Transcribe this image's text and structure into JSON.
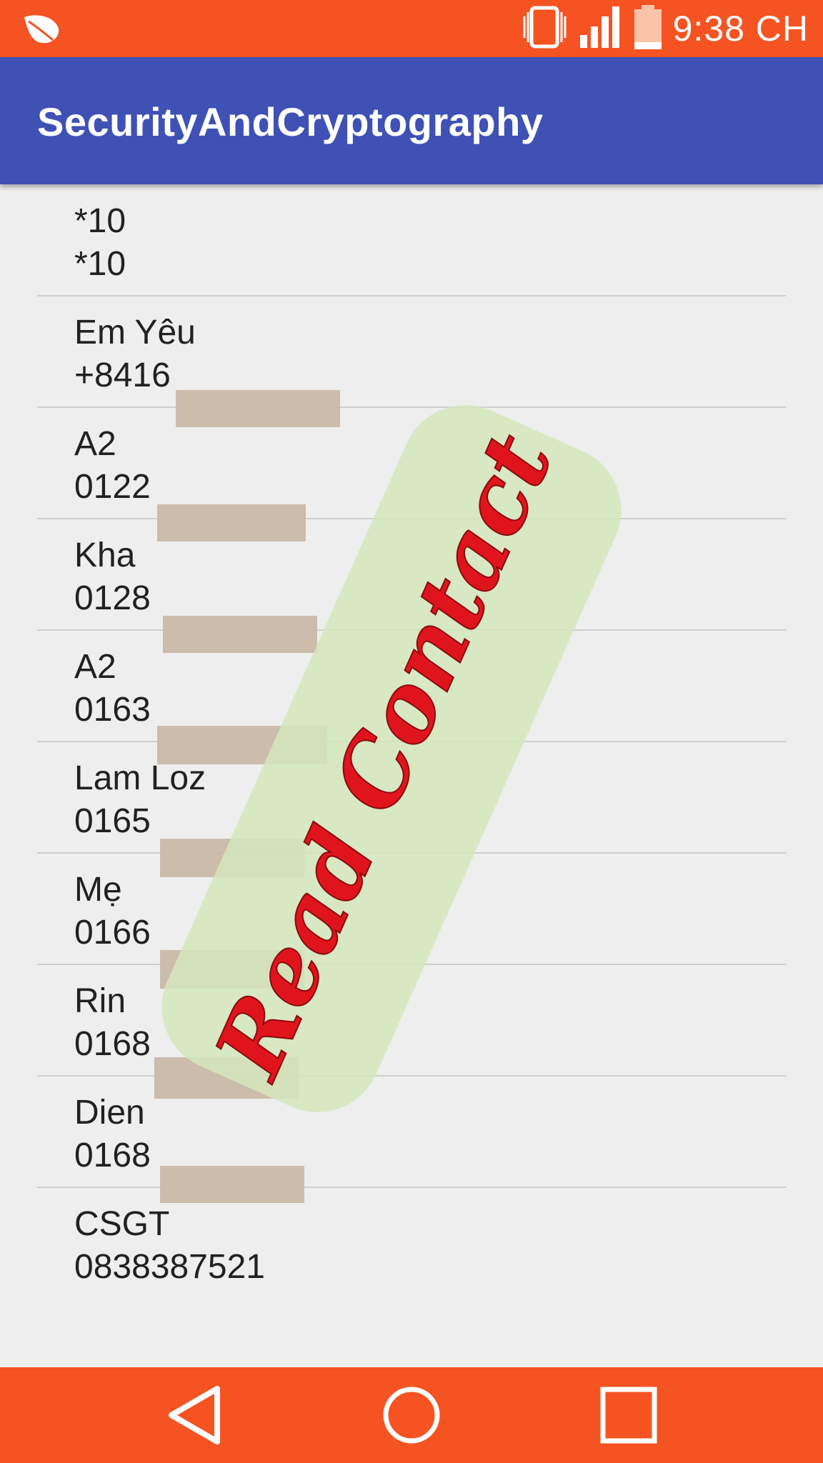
{
  "status_bar": {
    "time": "9:38 CH",
    "icons": [
      "leaf-icon",
      "vibrate-icon",
      "signal-icon",
      "battery-icon"
    ]
  },
  "app_bar": {
    "title": "SecurityAndCryptography"
  },
  "contacts": [
    {
      "name": "*10",
      "phone": "*10"
    },
    {
      "name": "Em Yêu",
      "phone": "+8416"
    },
    {
      "name": "A2",
      "phone": "0122"
    },
    {
      "name": "Kha",
      "phone": "0128"
    },
    {
      "name": "A2",
      "phone": "0163"
    },
    {
      "name": "Lam Loz",
      "phone": "0165"
    },
    {
      "name": "Mẹ",
      "phone": "0166"
    },
    {
      "name": "Rin",
      "phone": "0168"
    },
    {
      "name": "Dien",
      "phone": "0168"
    },
    {
      "name": "CSGT",
      "phone": "0838387521"
    }
  ],
  "watermark": {
    "text": "Read Contact"
  },
  "nav_bar": {
    "icons": [
      "back-icon",
      "home-icon",
      "recents-icon"
    ]
  },
  "colors": {
    "status_bar": "#f55322",
    "app_bar": "#3f51b5",
    "background": "#eeeeee",
    "watermark_text": "#e0141c"
  }
}
